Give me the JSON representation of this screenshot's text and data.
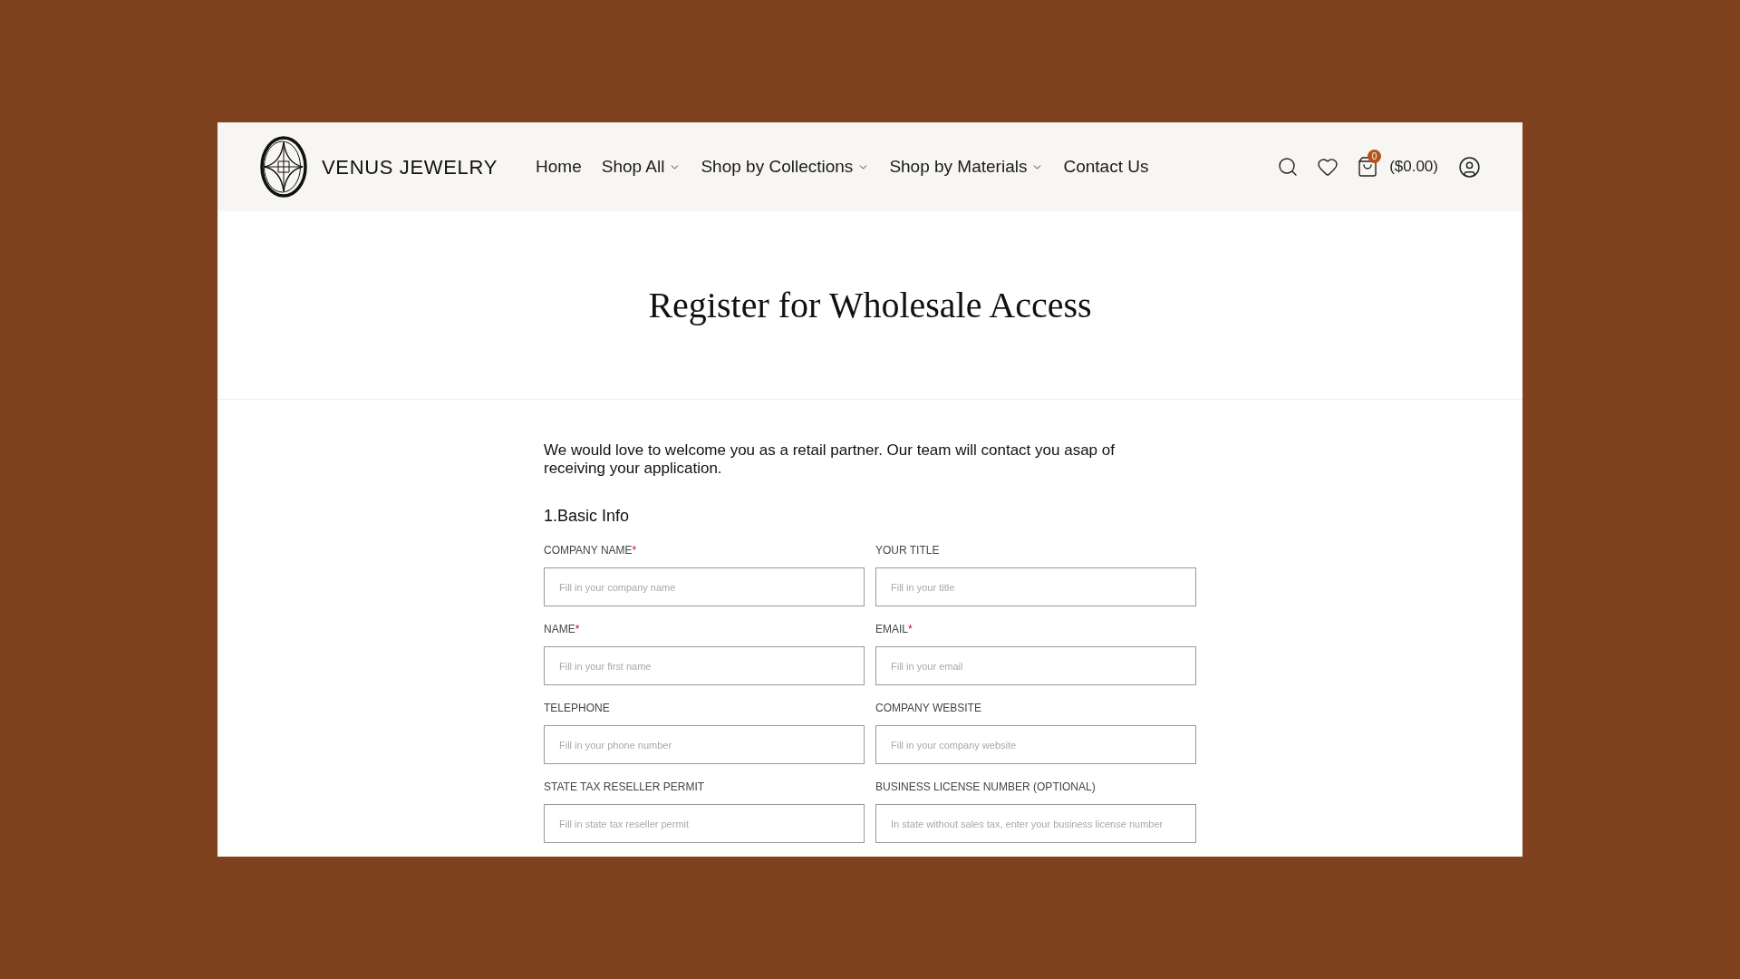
{
  "header": {
    "brand": "VENUS JEWELRY",
    "nav": [
      {
        "label": "Home",
        "dropdown": false
      },
      {
        "label": "Shop All",
        "dropdown": true
      },
      {
        "label": "Shop by Collections",
        "dropdown": true
      },
      {
        "label": "Shop by Materials",
        "dropdown": true
      },
      {
        "label": "Contact Us",
        "dropdown": false
      }
    ],
    "cart": {
      "count": "0",
      "total": "($0.00)"
    }
  },
  "page": {
    "title": "Register for Wholesale Access"
  },
  "form": {
    "intro": "We would love to welcome you as a retail partner. Our team will contact you asap of receiving your application.",
    "section": "1.Basic Info",
    "required_mark": "*",
    "fields": [
      {
        "label": "COMPANY NAME",
        "required": true,
        "placeholder": "Fill in your company name"
      },
      {
        "label": "YOUR TITLE",
        "required": false,
        "placeholder": "Fill in your title"
      },
      {
        "label": "NAME",
        "required": true,
        "placeholder": "Fill in your first name"
      },
      {
        "label": "EMAIL",
        "required": true,
        "placeholder": "Fill in your email"
      },
      {
        "label": "TELEPHONE",
        "required": false,
        "placeholder": "Fill in your phone number"
      },
      {
        "label": "COMPANY WEBSITE",
        "required": false,
        "placeholder": "Fill in your company website"
      },
      {
        "label": "STATE TAX RESELLER PERMIT",
        "required": false,
        "placeholder": "Fill in state tax reseller permit"
      },
      {
        "label": "BUSINESS LICENSE NUMBER (OPTIONAL)",
        "required": false,
        "placeholder": "In state without sales tax, enter your business license number"
      }
    ]
  }
}
